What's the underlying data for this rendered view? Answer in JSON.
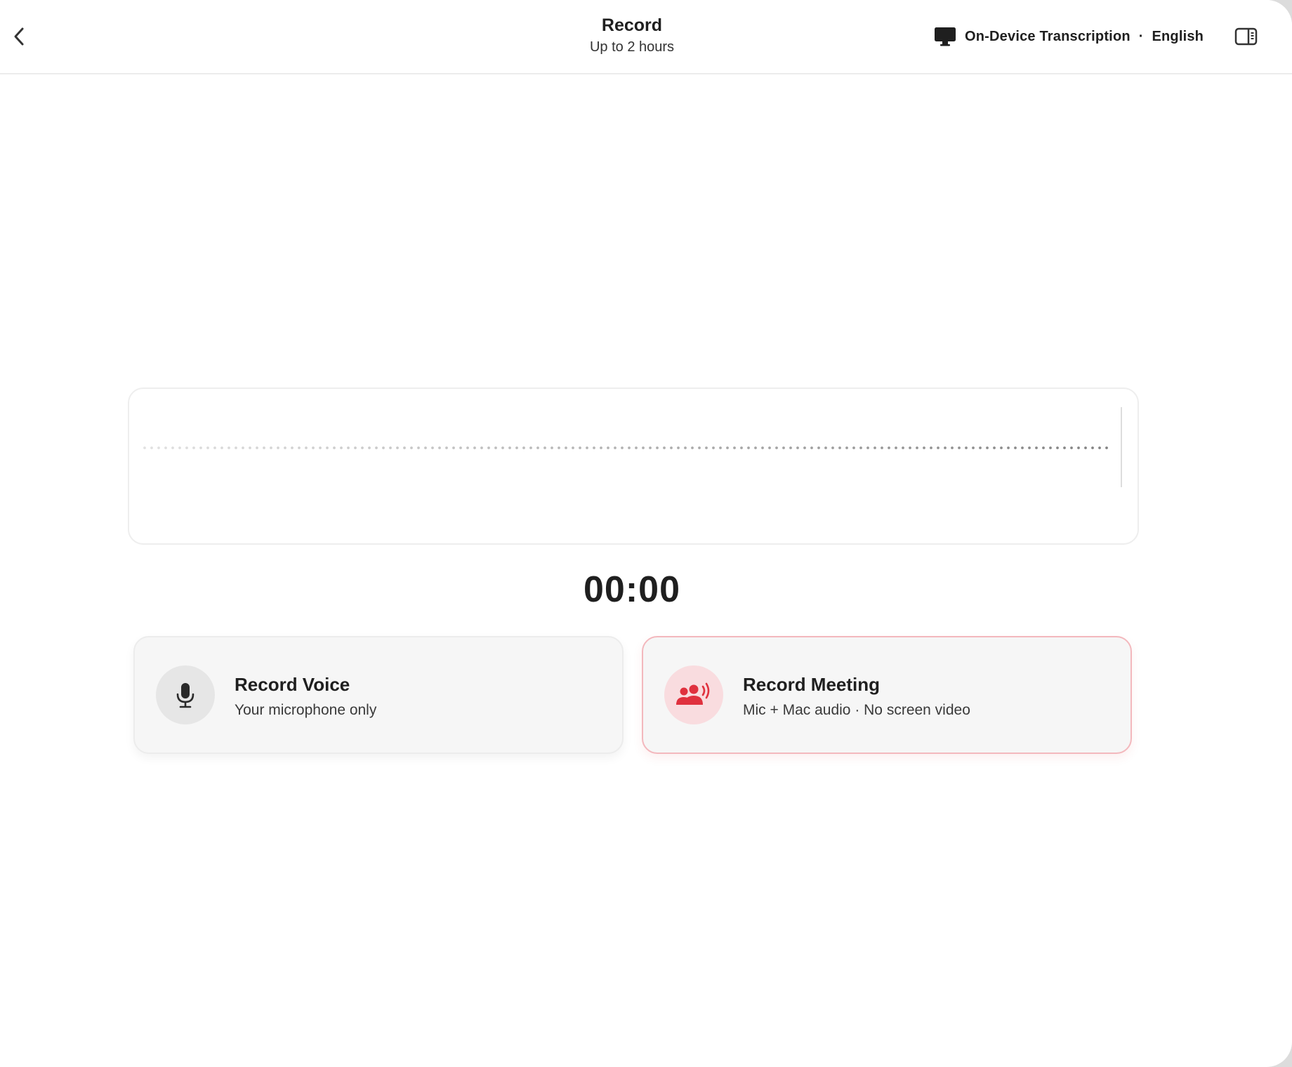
{
  "header": {
    "title": "Record",
    "subtitle": "Up to 2 hours",
    "back_icon": "chevron-left-icon",
    "transcription": {
      "icon": "monitor-icon",
      "mode": "On-Device Transcription",
      "separator": "·",
      "language": "English"
    },
    "sidebar_icon": "sidebar-toggle-icon"
  },
  "recorder": {
    "timer": "00:00"
  },
  "options": {
    "voice": {
      "icon": "microphone-icon",
      "title": "Record Voice",
      "subtitle": "Your microphone only"
    },
    "meeting": {
      "icon": "group-audio-icon",
      "title": "Record Meeting",
      "subtitle": "Mic + Mac audio · No screen video"
    }
  },
  "colors": {
    "accent_red": "#e0313e",
    "meeting_icon_bg": "#f9dcdf",
    "meeting_border": "#f3b8bd",
    "voice_icon_bg": "#e6e6e6",
    "card_bg": "#f6f6f6"
  }
}
